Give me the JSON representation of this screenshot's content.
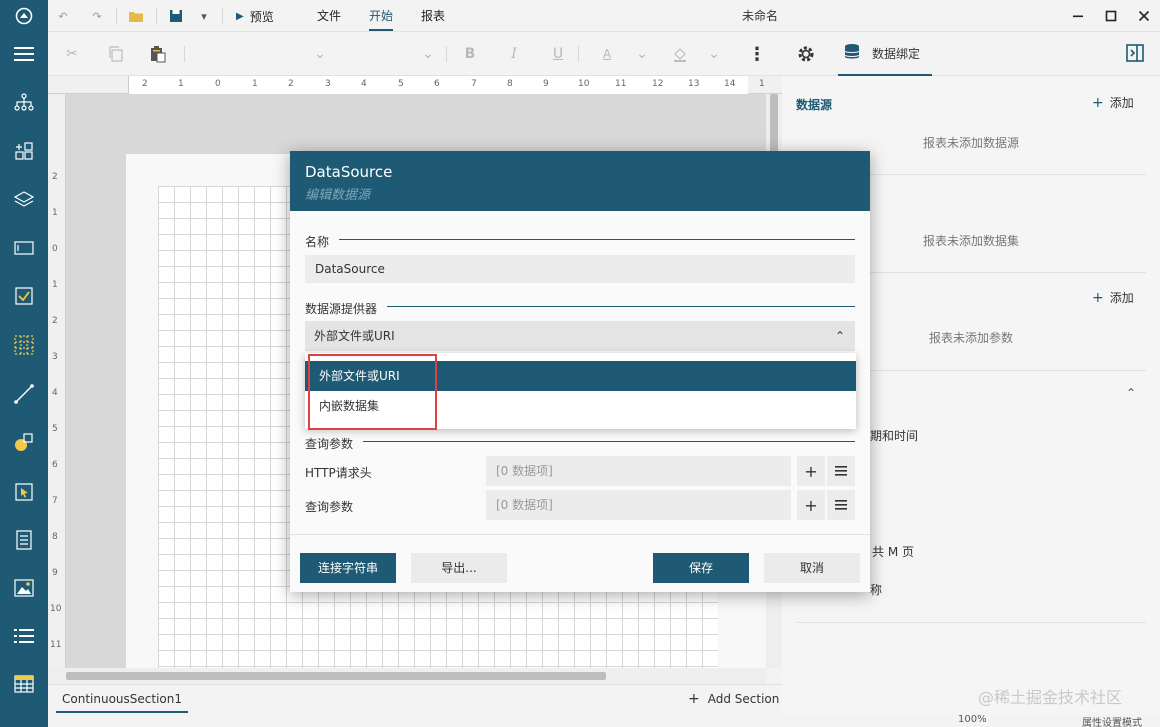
{
  "titlebar": {
    "preview_label": "预览",
    "menu": [
      "文件",
      "开始",
      "报表"
    ],
    "window_title": "未命名"
  },
  "right_header": {
    "tab_label": "数据绑定"
  },
  "right_panel": {
    "datasource_title": "数据源",
    "add_label": "添加",
    "datasource_empty": "报表未添加数据源",
    "dataset_empty": "报表未添加数据集",
    "param_add_label": "添加",
    "param_empty": "报表未添加参数",
    "datetime_partial": "期和时间",
    "page_partial": "、共 M 页",
    "name_partial": "称"
  },
  "ruler_h": [
    "2",
    "1",
    "0",
    "1",
    "2",
    "3",
    "4",
    "5",
    "6",
    "7",
    "8",
    "9",
    "10",
    "11",
    "12",
    "13",
    "14",
    "1"
  ],
  "ruler_v": [
    "2",
    "1",
    "0",
    "1",
    "2",
    "3",
    "4",
    "5",
    "6",
    "7",
    "8",
    "9",
    "10",
    "11"
  ],
  "bottom": {
    "section_tab": "ContinuousSection1",
    "add_section": "Add Section"
  },
  "status": {
    "zoom": "100%",
    "mode": "属性设置模式"
  },
  "watermark": "@稀土掘金技术社区",
  "modal": {
    "title": "DataSource",
    "subtitle": "编辑数据源",
    "name_label": "名称",
    "name_value": "DataSource",
    "provider_label": "数据源提供器",
    "provider_selected": "外部文件或URI",
    "provider_options": [
      "外部文件或URI",
      "内嵌数据集"
    ],
    "query_label": "查询参数",
    "http_header_label": "HTTP请求头",
    "http_header_placeholder": "[0 数据项]",
    "query_param_label": "查询参数",
    "query_param_placeholder": "[0 数据项]",
    "buttons": {
      "connection_string": "连接字符串",
      "export": "导出...",
      "save": "保存",
      "cancel": "取消"
    }
  },
  "colors": {
    "accent": "#1e5a73",
    "highlight_border": "#e04040"
  }
}
